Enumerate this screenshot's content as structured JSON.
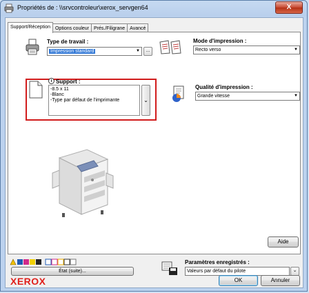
{
  "window": {
    "title": "Propriétés de : \\\\srvcontroleur\\xerox_servgen64",
    "close_label": "X"
  },
  "tabs": [
    {
      "label": "Support/Réception"
    },
    {
      "label": "Options couleur"
    },
    {
      "label": "Prés./Filigrane"
    },
    {
      "label": "Avancé"
    }
  ],
  "job_type": {
    "label": "Type de travail :",
    "value": "Impression standard",
    "more_label": "..."
  },
  "print_mode": {
    "label": "Mode d'impression :",
    "value": "Recto verso"
  },
  "support": {
    "label": "Support :",
    "lines": [
      "-8.5 x 11",
      "-Blanc",
      "-Type par défaut de l'imprimante"
    ]
  },
  "print_quality": {
    "label": "Qualité d'impression :",
    "value": "Grande vitesse"
  },
  "buttons": {
    "help": "Aide",
    "status": "État (suite)...",
    "ok": "OK",
    "cancel": "Annuler"
  },
  "saved_settings": {
    "label": "Paramètres enregistrés :",
    "value": "Valeurs par défaut du pilote"
  },
  "brand": "XEROX",
  "colors": {
    "accent": "#3379d7",
    "highlight_box": "#d11b1b",
    "brand": "#e0201b"
  }
}
